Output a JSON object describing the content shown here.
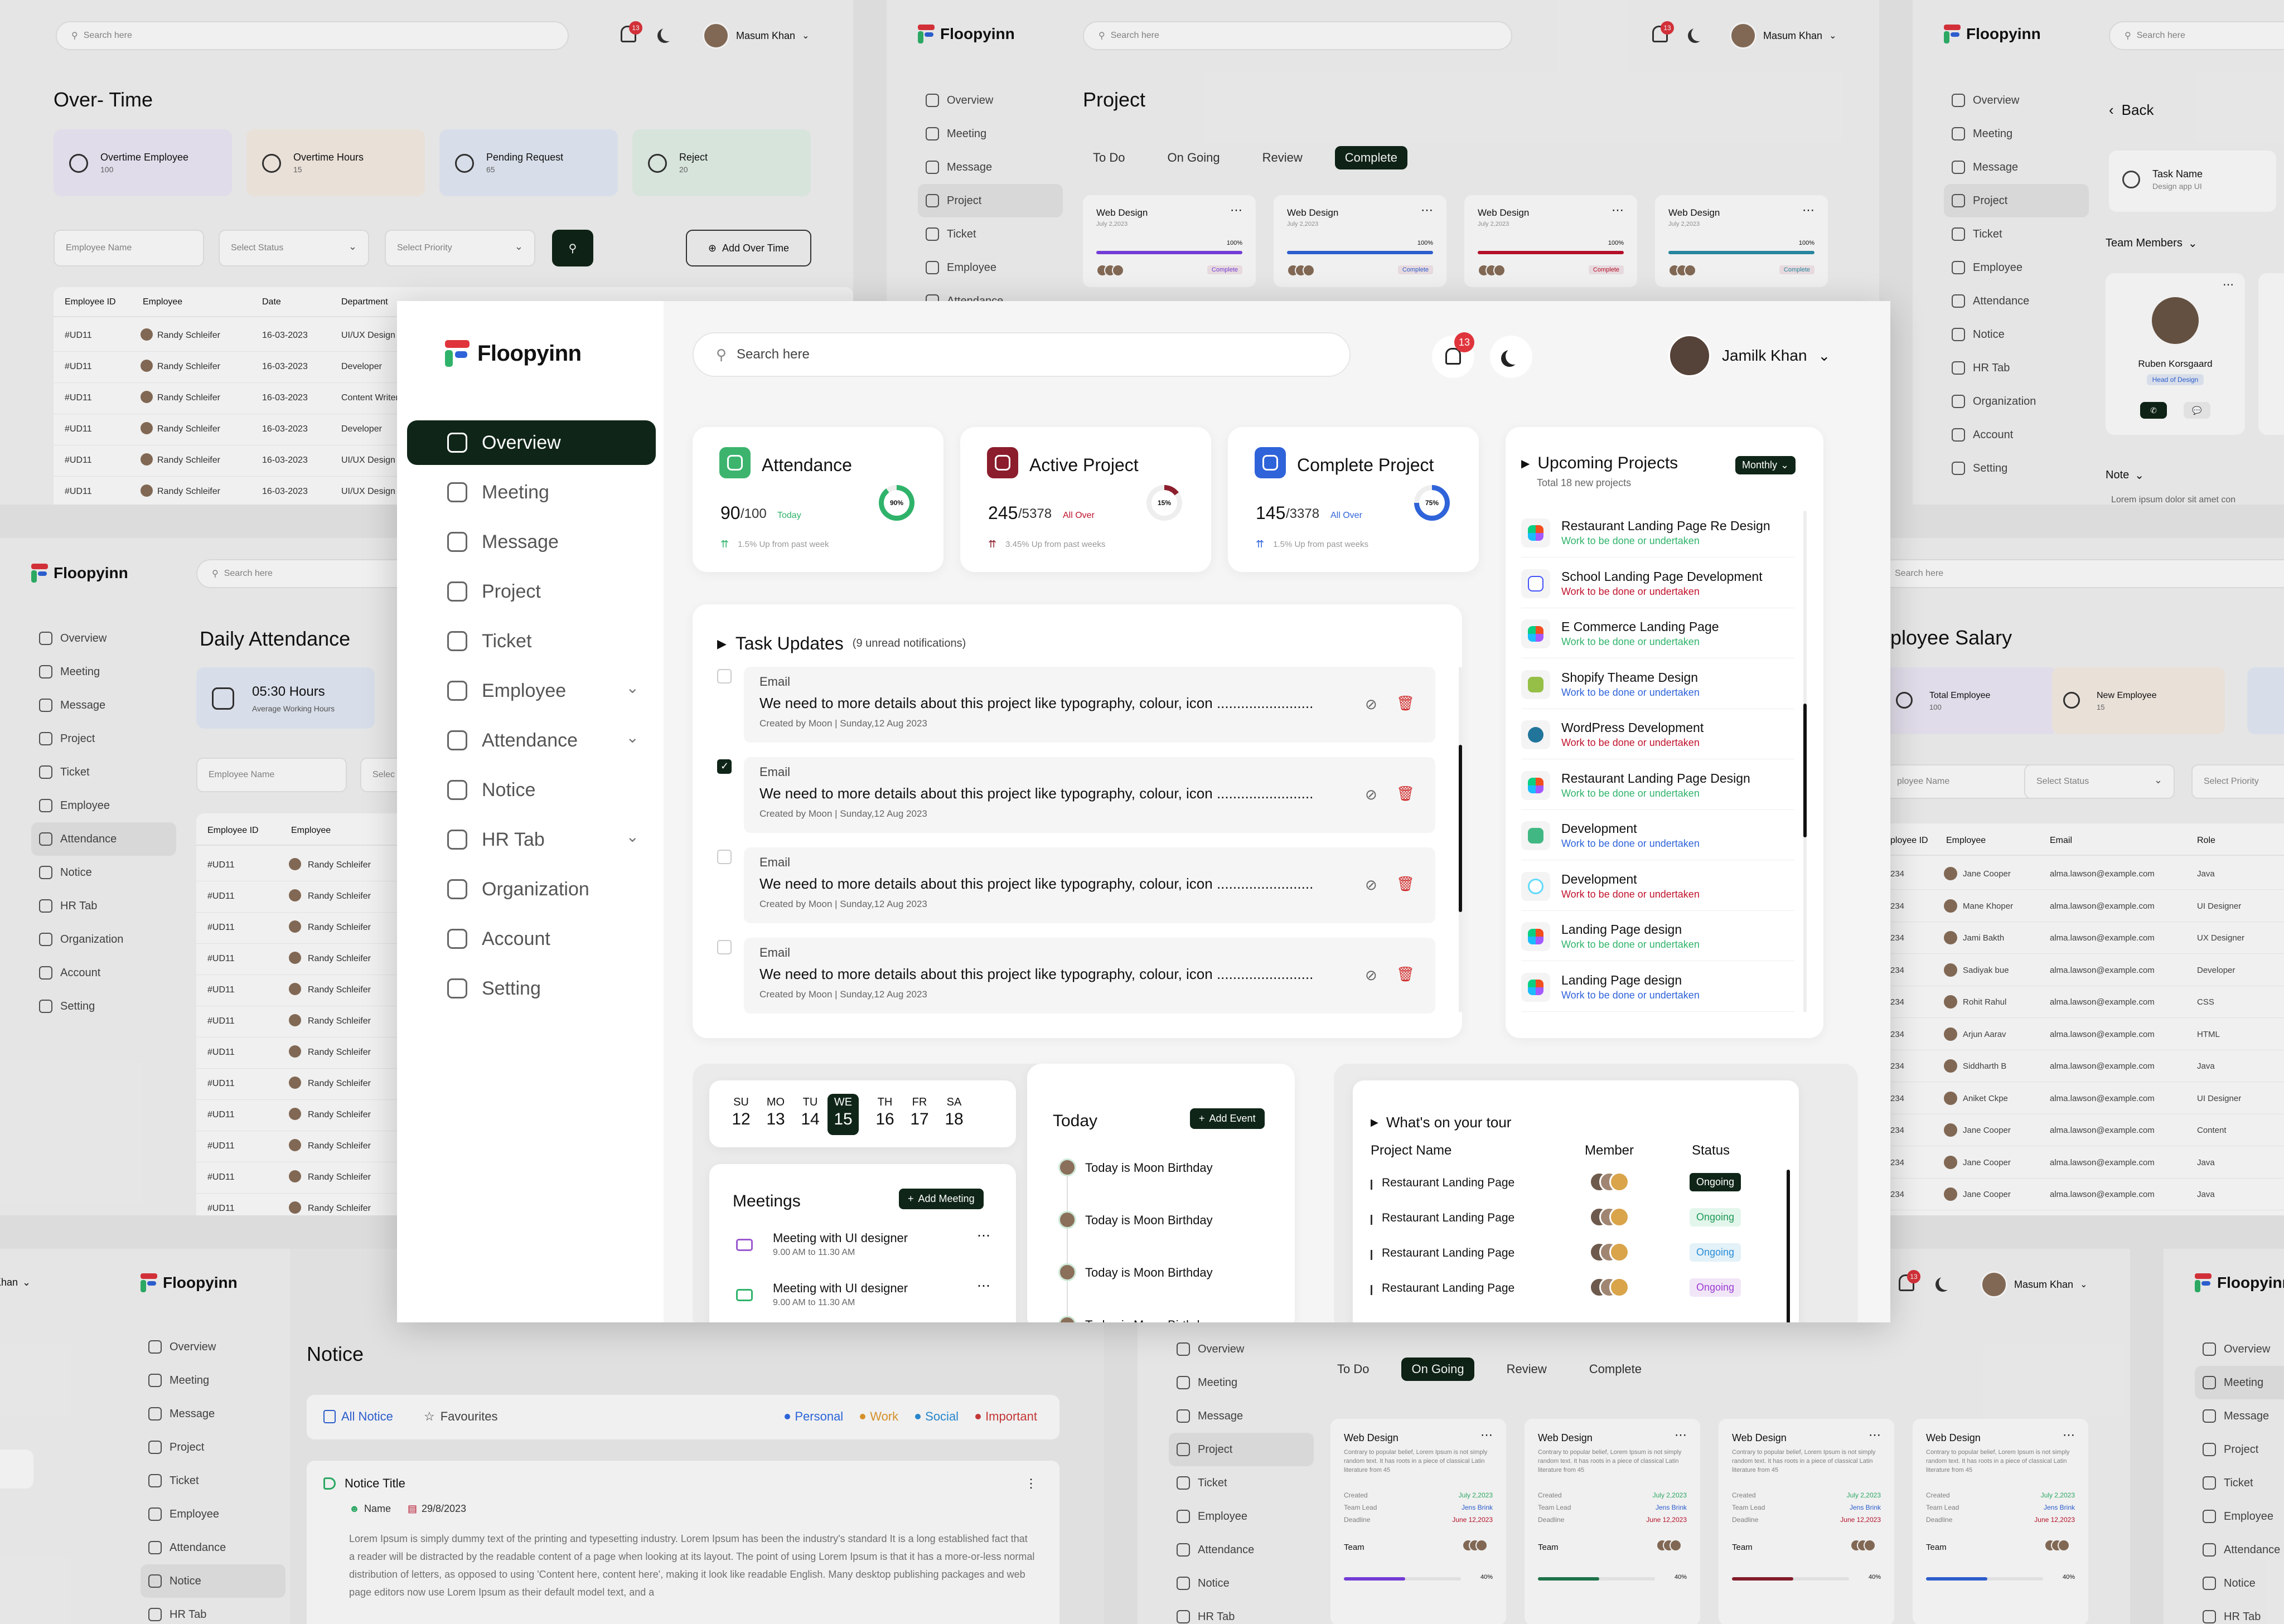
{
  "brand": "Floopyinn",
  "bg_overtime": {
    "search_placeholder": "Search here",
    "user": "Masum Khan",
    "badge": "13",
    "title": "Over- Time",
    "stats": [
      {
        "label": "Overtime Employee",
        "value": "100",
        "color": "#efeaf8"
      },
      {
        "label": "Overtime Hours",
        "value": "15",
        "color": "#f8efe6"
      },
      {
        "label": "Pending Request",
        "value": "65",
        "color": "#e6ecf8"
      },
      {
        "label": "Reject",
        "value": "20",
        "color": "#e5f3ea"
      }
    ],
    "filters": [
      "Employee Name",
      "Select Status",
      "Select Priority"
    ],
    "add_btn": "Add Over Time",
    "cols": [
      "Employee ID",
      "Employee",
      "Date",
      "Department"
    ],
    "rows": [
      [
        "#UD11",
        "Randy Schleifer",
        "16-03-2023",
        "UI/UX Design"
      ],
      [
        "#UD11",
        "Randy Schleifer",
        "16-03-2023",
        "Developer"
      ],
      [
        "#UD11",
        "Randy Schleifer",
        "16-03-2023",
        "Content Writer"
      ],
      [
        "#UD11",
        "Randy Schleifer",
        "16-03-2023",
        "Developer"
      ],
      [
        "#UD11",
        "Randy Schleifer",
        "16-03-2023",
        "UI/UX Design"
      ],
      [
        "#UD11",
        "Randy Schleifer",
        "16-03-2023",
        "UI/UX Design"
      ]
    ]
  },
  "bg_project": {
    "title": "Project",
    "user": "Masum Khan",
    "badge": "13",
    "tabs": [
      "To Do",
      "On Going",
      "Review",
      "Complete"
    ],
    "card_title": "Web Design",
    "card_date": "July 2,2023",
    "card_pct": "100%",
    "card_status": "Complete",
    "nav": [
      "Overview",
      "Meeting",
      "Message",
      "Project",
      "Ticket",
      "Employee",
      "Attendance"
    ]
  },
  "bg_team": {
    "back": "Back",
    "task_name": "Task Name",
    "task_sub": "Design app UI",
    "team_members": "Team Members",
    "member_name": "Ruben Korsgaard",
    "member_role": "Head of Design",
    "note": "Note",
    "note_text": "Lorem ipsum dolor sit amet con",
    "nav": [
      "Overview",
      "Meeting",
      "Message",
      "Project",
      "Ticket",
      "Employee",
      "Attendance",
      "Notice",
      "HR Tab",
      "Organization",
      "Account",
      "Setting"
    ]
  },
  "bg_daily": {
    "title": "Daily Attendance",
    "hours": "05:30 Hours",
    "hours_sub": "Average Working Hours",
    "filter": "Employee Name",
    "filter2": "Selec",
    "cols": [
      "Employee ID",
      "Employee"
    ],
    "row_id": "#UD11",
    "row_name": "Randy Schleifer",
    "nav": [
      "Overview",
      "Meeting",
      "Message",
      "Project",
      "Ticket",
      "Employee",
      "Attendance",
      "Notice",
      "HR Tab",
      "Organization",
      "Account",
      "Setting"
    ]
  },
  "bg_salary": {
    "title": "ployee Salary",
    "stats": [
      {
        "label": "Total Employee",
        "value": "100"
      },
      {
        "label": "New Employee",
        "value": "15"
      }
    ],
    "filters": [
      "ployee Name",
      "Select Status",
      "Select Priority"
    ],
    "cols": [
      "ployee ID",
      "Employee",
      "Email",
      "Role"
    ],
    "rows": [
      [
        "234",
        "Jane Cooper",
        "alma.lawson@example.com",
        "Java"
      ],
      [
        "234",
        "Mane Khoper",
        "alma.lawson@example.com",
        "UI Designer"
      ],
      [
        "234",
        "Jami Bakth",
        "alma.lawson@example.com",
        "UX Designer"
      ],
      [
        "234",
        "Sadiyak bue",
        "alma.lawson@example.com",
        "Developer"
      ],
      [
        "234",
        "Rohit Rahul",
        "alma.lawson@example.com",
        "CSS"
      ],
      [
        "234",
        "Arjun Aarav",
        "alma.lawson@example.com",
        "HTML"
      ],
      [
        "234",
        "Siddharth B",
        "alma.lawson@example.com",
        "Java"
      ],
      [
        "234",
        "Aniket Ckpe",
        "alma.lawson@example.com",
        "UI Designer"
      ],
      [
        "234",
        "Jane Cooper",
        "alma.lawson@example.com",
        "Content"
      ],
      [
        "234",
        "Jane Cooper",
        "alma.lawson@example.com",
        "Java"
      ],
      [
        "234",
        "Jane Cooper",
        "alma.lawson@example.com",
        "Java"
      ]
    ],
    "search": "Search here"
  },
  "bg_notice": {
    "title": "Notice",
    "user_partial": "Khan",
    "tabs": [
      "All Notice",
      "Favourites"
    ],
    "cats": [
      {
        "label": "Personal",
        "color": "#2e6be6"
      },
      {
        "label": "Work",
        "color": "#e39a2e"
      },
      {
        "label": "Social",
        "color": "#2a8ed8"
      },
      {
        "label": "Important",
        "color": "#d03b3b"
      }
    ],
    "notice_title": "Notice Title",
    "name": "Name",
    "date": "29/8/2023",
    "body": "Lorem Ipsum is simply dummy text of the printing and typesetting industry. Lorem Ipsum has been the industry's standard It is a long established fact that a reader will be distracted by the readable content of a page when looking at its layout. The point of using Lorem Ipsum is that it has a more-or-less normal distribution of letters, as opposed to using 'Content here, content here', making it look like readable English. Many desktop publishing packages and web page editors now use Lorem Ipsum as their default model text, and a",
    "nav": [
      "Overview",
      "Meeting",
      "Message",
      "Project",
      "Ticket",
      "Employee",
      "Attendance",
      "Notice",
      "HR Tab"
    ]
  },
  "bg_ongoing": {
    "user": "Masum Khan",
    "badge": "13",
    "tabs": [
      "To Do",
      "On Going",
      "Review",
      "Complete"
    ],
    "card_title": "Web Design",
    "card_desc": "Contrary to popular belief, Lorem Ipsum is not simply random text. It has roots in a piece of classical Latin literature from 45",
    "created": "Created",
    "created_v": "July 2,2023",
    "lead": "Team Lead",
    "lead_v": "Jens Brink",
    "deadline": "Deadline",
    "deadline_v": "June 12,2023",
    "team": "Team",
    "pct": "40%",
    "nav": [
      "Overview",
      "Meeting",
      "Message",
      "Project",
      "Ticket",
      "Employee",
      "Attendance",
      "Notice",
      "HR Tab"
    ]
  },
  "bg_right": {
    "nav": [
      "Overview",
      "Meeting",
      "Message",
      "Project",
      "Ticket",
      "Employee",
      "Attendance",
      "Notice",
      "HR Tab"
    ]
  },
  "main": {
    "search_placeholder": "Search here",
    "notif_count": "13",
    "user_name": "Jamilk Khan",
    "nav": [
      {
        "label": "Overview",
        "active": true,
        "chev": false
      },
      {
        "label": "Meeting",
        "chev": false
      },
      {
        "label": "Message",
        "chev": false
      },
      {
        "label": "Project",
        "chev": false
      },
      {
        "label": "Ticket",
        "chev": false
      },
      {
        "label": "Employee",
        "chev": true
      },
      {
        "label": "Attendance",
        "chev": true
      },
      {
        "label": "Notice",
        "chev": false
      },
      {
        "label": "HR Tab",
        "chev": true
      },
      {
        "label": "Organization",
        "chev": false
      },
      {
        "label": "Account",
        "chev": false
      },
      {
        "label": "Setting",
        "chev": false
      }
    ],
    "stats": [
      {
        "title": "Attendance",
        "value": "90",
        "total": "/100",
        "tag": "Today",
        "ring": "90%",
        "progress": 0.9,
        "trend": "1.5% Up from past week",
        "icon_bg": "#3cb46e",
        "ring_color": "#2fb36a",
        "tag_color": "#2fb36a",
        "trend_color": "#2fb36a"
      },
      {
        "title": "Active Project",
        "value": "245",
        "total": "/5378",
        "tag": "All Over",
        "ring": "15%",
        "progress": 0.15,
        "trend": "3.45% Up from past weeks",
        "icon_bg": "#8b1d2c",
        "ring_color": "#8b1d2c",
        "tag_color": "#c0122c",
        "trend_color": "#8b1d2c"
      },
      {
        "title": "Complete Project",
        "value": "145",
        "total": "/3378",
        "tag": "All Over",
        "ring": "75%",
        "progress": 0.75,
        "trend": "1.5% Up from past weeks",
        "icon_bg": "#2f63d9",
        "ring_color": "#2f63d9",
        "tag_color": "#2f63d9",
        "trend_color": "#2f63d9"
      }
    ],
    "task_updates": {
      "title": "Task Updates",
      "subtitle": "(9 unread notifications)",
      "items": [
        {
          "type": "Email",
          "text": "We need to more details about this project like typography, colour, icon ........................",
          "meta": "Created by Moon | Sunday,12 Aug 2023",
          "checked": false
        },
        {
          "type": "Email",
          "text": "We need to more details about this project like typography, colour, icon ........................",
          "meta": "Created by Moon | Sunday,12 Aug 2023",
          "checked": true
        },
        {
          "type": "Email",
          "text": "We need to more details about this project like typography, colour, icon ........................",
          "meta": "Created by Moon | Sunday,12 Aug 2023",
          "checked": false
        },
        {
          "type": "Email",
          "text": "We need to more details about this project like typography, colour, icon ........................",
          "meta": "Created by Moon | Sunday,12 Aug 2023",
          "checked": false
        }
      ]
    },
    "upcoming": {
      "title": "Upcoming Projects",
      "subtitle": "Total 18 new projects",
      "filter": "Monthly",
      "items": [
        {
          "name": "Restaurant Landing Page Re Design",
          "sub": "Work to be done or undertaken",
          "logo": "figma",
          "sub_color": "#2fb36a"
        },
        {
          "name": "School Landing Page Development",
          "sub": "Work to be done or undertaken",
          "logo": "webflow",
          "sub_color": "#c0122c"
        },
        {
          "name": "E Commerce Landing Page",
          "sub": "Work to be done or undertaken",
          "logo": "figma",
          "sub_color": "#2fb36a"
        },
        {
          "name": "Shopify Theame Design",
          "sub": "Work to be done or undertaken",
          "logo": "shopify",
          "sub_color": "#2f63d9"
        },
        {
          "name": "WordPress Development",
          "sub": "Work to be done or undertaken",
          "logo": "wordpress",
          "sub_color": "#c0122c"
        },
        {
          "name": "Restaurant Landing Page Design",
          "sub": "Work to be done or undertaken",
          "logo": "figma",
          "sub_color": "#2fb36a"
        },
        {
          "name": "Development",
          "sub": "Work to be done or undertaken",
          "logo": "vue",
          "sub_color": "#2f63d9"
        },
        {
          "name": "Development",
          "sub": "Work to be done or undertaken",
          "logo": "react",
          "sub_color": "#c0122c"
        },
        {
          "name": "Landing Page design",
          "sub": "Work to be done or undertaken",
          "logo": "figma",
          "sub_color": "#2fb36a"
        },
        {
          "name": "Landing Page design",
          "sub": "Work to be done or undertaken",
          "logo": "figma",
          "sub_color": "#2f63d9"
        }
      ]
    },
    "calendar": [
      {
        "d": "SU",
        "n": "12"
      },
      {
        "d": "MO",
        "n": "13"
      },
      {
        "d": "TU",
        "n": "14"
      },
      {
        "d": "WE",
        "n": "15",
        "active": true
      },
      {
        "d": "TH",
        "n": "16"
      },
      {
        "d": "FR",
        "n": "17"
      },
      {
        "d": "SA",
        "n": "18"
      }
    ],
    "meetings": {
      "title": "Meetings",
      "add": "Add Meeting",
      "items": [
        {
          "title": "Meeting with UI designer",
          "time": "9.00 AM to 11.30 AM",
          "color": "#9b59d0"
        },
        {
          "title": "Meeting with UI designer",
          "time": "9.00 AM to 11.30 AM",
          "color": "#2fb36a"
        }
      ]
    },
    "today": {
      "title": "Today",
      "add": "Add Event",
      "items": [
        "Today is  Moon Birthday",
        "Today is  Moon Birthday",
        "Today is  Moon Birthday",
        "Today is  Moon Birthday"
      ]
    },
    "tour": {
      "title": "What's on your tour",
      "cols": [
        "Project Name",
        "Member",
        "Status"
      ],
      "rows": [
        {
          "name": "Restaurant Landing Page",
          "status": "Ongoing",
          "style": "dark"
        },
        {
          "name": "Restaurant Landing Page",
          "status": "Ongoing",
          "style": "green"
        },
        {
          "name": "Restaurant Landing Page",
          "status": "Ongoing",
          "style": "blue"
        },
        {
          "name": "Restaurant Landing Page",
          "status": "Ongoing",
          "style": "purple"
        }
      ]
    }
  }
}
